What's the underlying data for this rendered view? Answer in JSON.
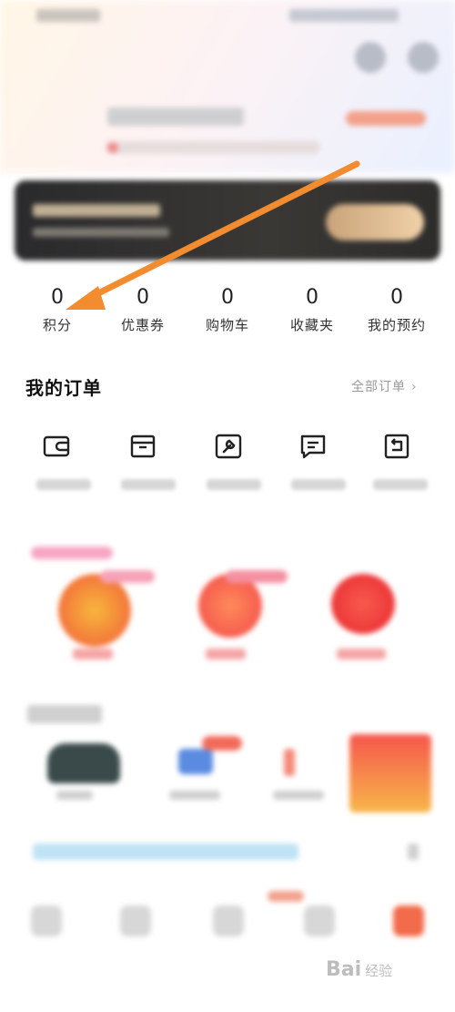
{
  "stats": [
    {
      "value": "0",
      "label": "积分"
    },
    {
      "value": "0",
      "label": "优惠券"
    },
    {
      "value": "0",
      "label": "购物车"
    },
    {
      "value": "0",
      "label": "收藏夹"
    },
    {
      "value": "0",
      "label": "我的预约"
    }
  ],
  "orders": {
    "title": "我的订单",
    "all_label": "全部订单",
    "icons": [
      "wallet-icon",
      "box-icon",
      "wrench-icon",
      "chat-icon",
      "return-icon"
    ]
  },
  "watermark": {
    "text": "Bai",
    "suffix": "经验"
  },
  "colors": {
    "arrow": "#f28c2e",
    "vip_card": "#2a2a2c",
    "vip_button": "#e6c299"
  }
}
